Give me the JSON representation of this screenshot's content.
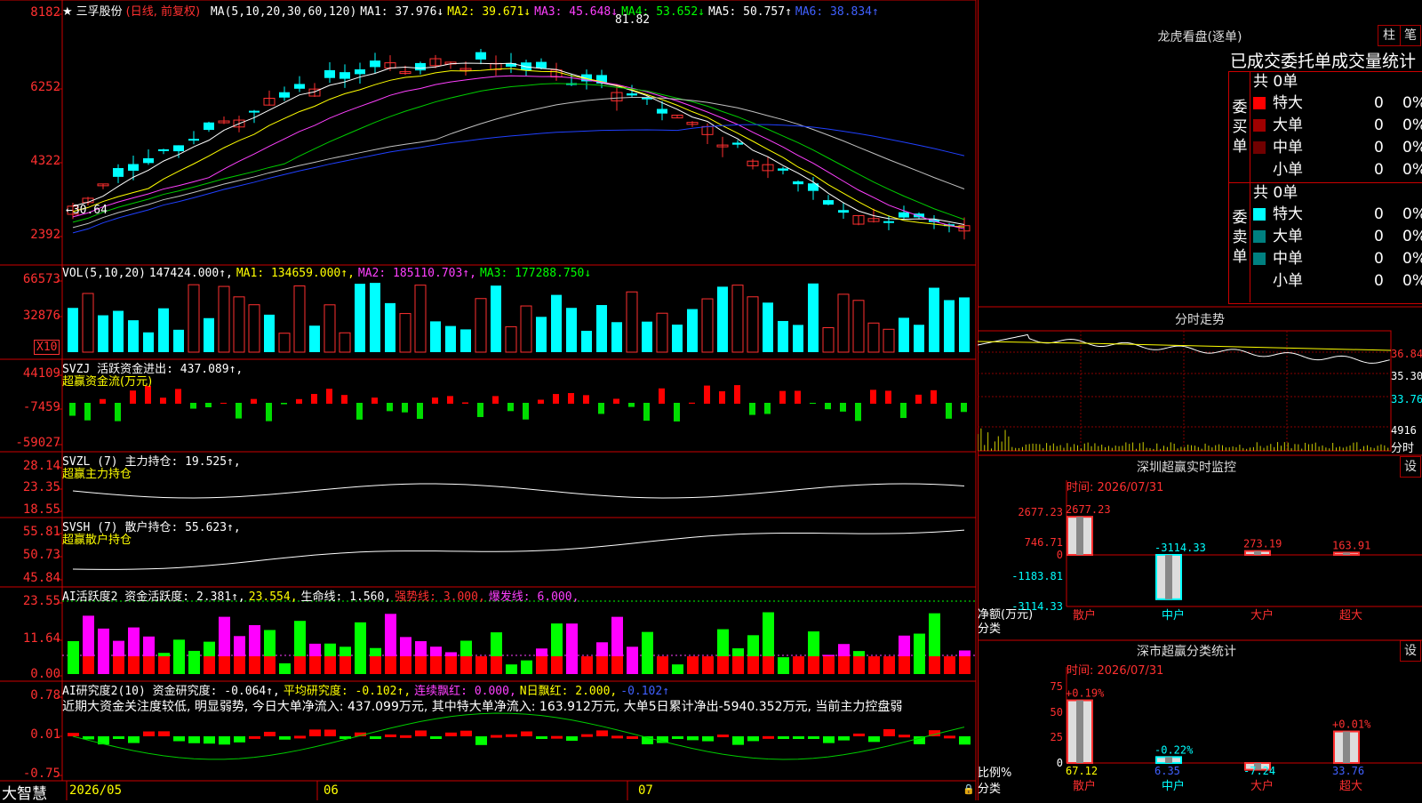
{
  "brand": "大智慧",
  "stock": {
    "star": "★",
    "name": "三孚股份",
    "mode": "(日线, 前复权)"
  },
  "ma_header": {
    "label": "MA(5,10,20,30,60,120)",
    "ma1": "MA1: 37.976↓",
    "ma2": "MA2: 39.671↓",
    "ma3": "MA3: 45.648↓",
    "ma4": "MA4: 53.652↓",
    "ma5": "MA5: 50.757↑",
    "ma6": "MA6: 38.834↑"
  },
  "price_axis": [
    "8182",
    "6252",
    "4322",
    "2392"
  ],
  "price_annot": {
    "high": "81.82",
    "low": "←30.64"
  },
  "vol_header": {
    "label": "VOL(5,10,20)",
    "v": "147424.000↑,",
    "ma1": "MA1: 134659.000↑,",
    "ma2": "MA2: 185110.703↑,",
    "ma3": "MA3: 177288.750↓"
  },
  "vol_axis": [
    "66573",
    "32876"
  ],
  "vol_unit": "X10",
  "svzj": {
    "label": "SVZJ  活跃资金进出: 437.089↑,",
    "sub": "超赢资金流(万元)",
    "axis": [
      "44109",
      "-7459",
      "-59027"
    ]
  },
  "svzl": {
    "label": "SVZL (7) 主力持仓: 19.525↑,",
    "sub": "超赢主力持仓",
    "axis": [
      "28.14",
      "23.35",
      "18.55"
    ]
  },
  "svsh": {
    "label": "SVSH (7) 散户持仓: 55.623↑,",
    "sub": "超赢散户持仓",
    "axis": [
      "55.81",
      "50.73",
      "45.84"
    ]
  },
  "ai_act": {
    "label": "AI活跃度2 资金活跃度: 2.381↑,",
    "v2": "23.554,",
    "life": "生命线: 1.560,",
    "strong": "强势线: 3.000,",
    "burst": "爆发线: 6.000,",
    "axis": [
      "23.55",
      "11.64",
      "0.00"
    ]
  },
  "ai_res": {
    "label": "AI研究度2(10) 资金研究度: -0.064↑,",
    "avg": "平均研究度: -0.102↑,",
    "cont": "连续飘红: 0.000,",
    "nday": "N日飘红: 2.000,",
    "last": "-0.102↑",
    "axis": [
      "0.78",
      "0.01",
      "-0.75"
    ],
    "comment": "近期大资金关注度较低, 明显弱势, 今日大单净流入: 437.099万元, 其中特大单净流入: 163.912万元, 大单5日累计净出-5940.352万元, 当前主力控盘弱"
  },
  "dates": [
    "2026/05",
    "06",
    "07"
  ],
  "lhb": {
    "title": "龙虎看盘(逐单)",
    "btn1": "柱",
    "btn2": "笔",
    "header": "已成交委托单成交量统计",
    "buy": {
      "side": "委买单",
      "total": "共 0单",
      "rows": [
        {
          "name": "特大",
          "v": "0",
          "p": "0%",
          "c": "#ff0000"
        },
        {
          "name": "大单",
          "v": "0",
          "p": "0%",
          "c": "#a00000"
        },
        {
          "name": "中单",
          "v": "0",
          "p": "0%",
          "c": "#700000"
        },
        {
          "name": "小单",
          "v": "0",
          "p": "0%",
          "c": ""
        }
      ]
    },
    "sell": {
      "side": "委卖单",
      "total": "共 0单",
      "rows": [
        {
          "name": "特大",
          "v": "0",
          "p": "0%",
          "c": "#00ffff"
        },
        {
          "name": "大单",
          "v": "0",
          "p": "0%",
          "c": "#008080"
        },
        {
          "name": "中单",
          "v": "0",
          "p": "0%",
          "c": "#008080"
        },
        {
          "name": "小单",
          "v": "0",
          "p": "0%",
          "c": ""
        }
      ]
    }
  },
  "intraday": {
    "title": "分时走势",
    "axis": [
      "36.84",
      "35.30",
      "33.76"
    ],
    "vol": "4916",
    "vlabel": "分时"
  },
  "sz_monitor": {
    "title": "深圳超赢实时监控",
    "btn": "设",
    "time": "时间: 2026/07/31",
    "ylabel": "净额(万元)",
    "xlabel": "分类",
    "axis": [
      "2677.23",
      "746.71",
      "0",
      "-1183.81",
      "-3114.33"
    ],
    "bars": [
      {
        "cat": "散户",
        "v": 2677.23,
        "label": "2677.23"
      },
      {
        "cat": "中户",
        "v": -3114.33,
        "label": "-3114.33"
      },
      {
        "cat": "大户",
        "v": 273.19,
        "label": "273.19"
      },
      {
        "cat": "超大",
        "v": 163.91,
        "label": "163.91"
      }
    ]
  },
  "sz_class": {
    "title": "深市超赢分类统计",
    "btn": "设",
    "time": "时间: 2026/07/31",
    "ylabel": "比例%",
    "xlabel": "分类",
    "axis": [
      "75",
      "50",
      "25",
      "0"
    ],
    "bars": [
      {
        "cat": "散户",
        "v": 67.12,
        "label": "+0.19%",
        "bottom": "67.12"
      },
      {
        "cat": "中户",
        "v": 6.35,
        "label": "-0.22%",
        "bottom": "6.35"
      },
      {
        "cat": "大户",
        "v": -7.24,
        "label": "",
        "bottom": "-7.24"
      },
      {
        "cat": "超大",
        "v": 33.76,
        "label": "+0.01%",
        "bottom": "33.76"
      }
    ]
  }
}
